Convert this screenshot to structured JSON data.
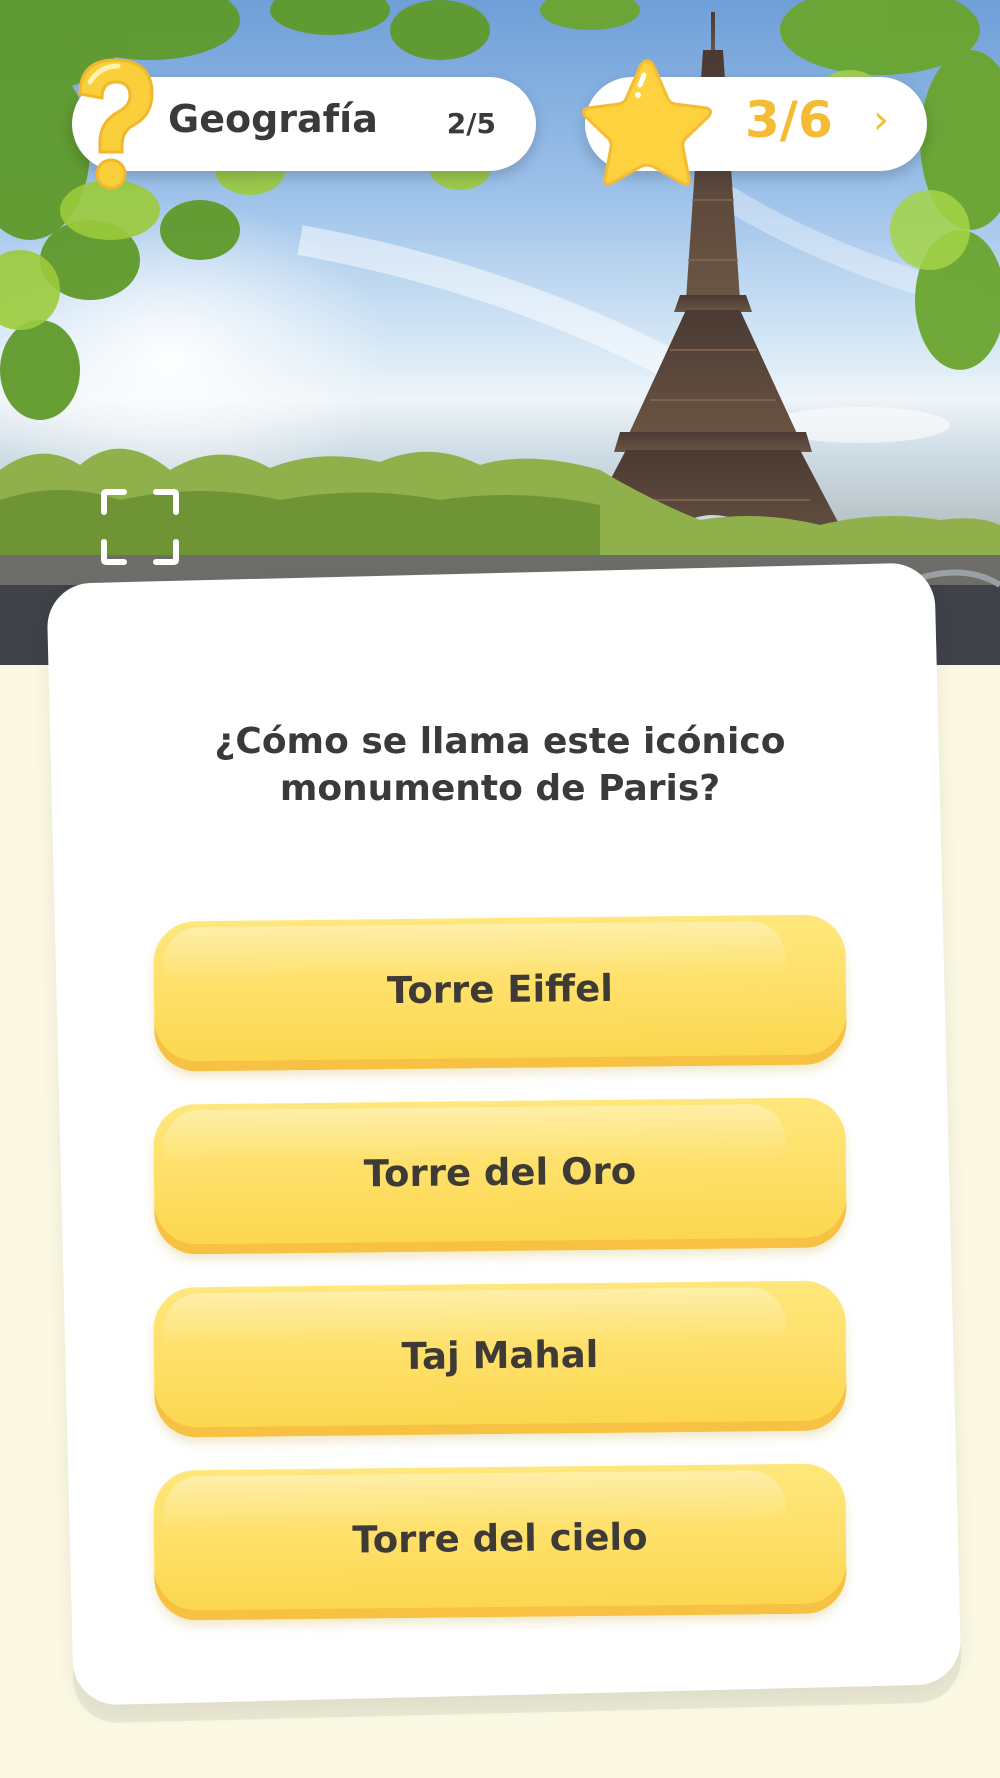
{
  "header": {
    "category": "Geografía",
    "question_progress": "2/5",
    "score": "3/6",
    "score_chevron": "›"
  },
  "icons": {
    "category_icon": "question-mark-icon",
    "score_icon": "star-icon",
    "expand_icon": "fullscreen-icon",
    "chevron_icon": "chevron-right-icon"
  },
  "image": {
    "description_semantic": "eiffel-tower-photo"
  },
  "question": {
    "text": "¿Cómo se llama este icónico monumento de Paris?"
  },
  "answers": [
    {
      "label": "Torre Eiffel"
    },
    {
      "label": "Torre del Oro"
    },
    {
      "label": "Taj Mahal"
    },
    {
      "label": "Torre del cielo"
    }
  ],
  "colors": {
    "accent_yellow": "#fcd64b",
    "score_text": "#f6bb34",
    "page_background": "#fbf9e3",
    "text_dark": "#3a3a3a"
  }
}
